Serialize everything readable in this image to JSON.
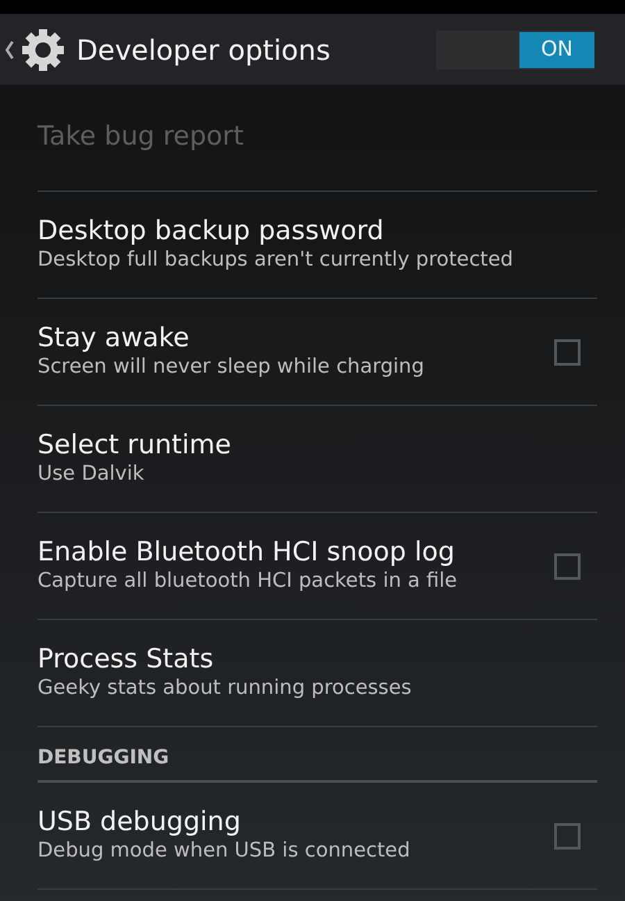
{
  "action_bar": {
    "title": "Developer options",
    "switch": {
      "label": "ON",
      "on": true
    }
  },
  "items": [
    {
      "kind": "item",
      "title": "Take bug report",
      "disabled": true
    },
    {
      "kind": "item",
      "title": "Desktop backup password",
      "summary": "Desktop full backups aren't currently protected",
      "disabled": false
    },
    {
      "kind": "item",
      "title": "Stay awake",
      "summary": "Screen will never sleep while charging",
      "disabled": false,
      "checked": false
    },
    {
      "kind": "item",
      "title": "Select runtime",
      "summary": "Use Dalvik",
      "disabled": false
    },
    {
      "kind": "item",
      "title": "Enable Bluetooth HCI snoop log",
      "summary": "Capture all bluetooth HCI packets in a file",
      "disabled": false,
      "checked": false
    },
    {
      "kind": "item",
      "title": "Process Stats",
      "summary": "Geeky stats about running processes",
      "disabled": false
    },
    {
      "kind": "header",
      "title": "DEBUGGING"
    },
    {
      "kind": "item",
      "title": "USB debugging",
      "summary": "Debug mode when USB is connected",
      "disabled": false,
      "checked": false
    }
  ]
}
